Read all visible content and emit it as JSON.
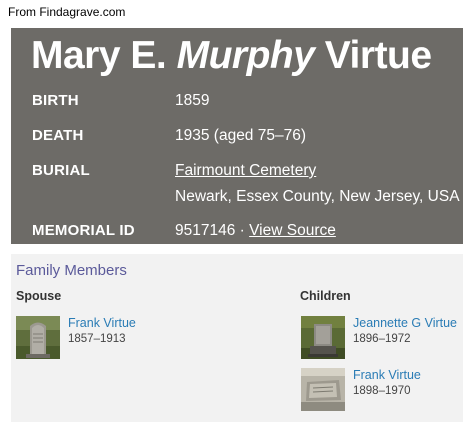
{
  "source_note": "From Findagrave.com",
  "memorial": {
    "name_first": "Mary E.",
    "name_middle": "Murphy",
    "name_last": "Virtue",
    "birth_label": "BIRTH",
    "birth_value": "1859",
    "death_label": "DEATH",
    "death_value": "1935 (aged 75–76)",
    "burial_label": "BURIAL",
    "burial_cemetery": "Fairmount Cemetery",
    "burial_location": "Newark, Essex County, New Jersey, USA",
    "memorial_id_label": "MEMORIAL ID",
    "memorial_id_value": "9517146 · ",
    "view_source_link": "View Source"
  },
  "family": {
    "heading": "Family Members",
    "spouse_heading": "Spouse",
    "children_heading": "Children",
    "spouse": [
      {
        "name": "Frank Virtue",
        "dates": "1857–1913",
        "photo_icon": "gravestone-photo"
      }
    ],
    "children": [
      {
        "name": "Jeannette G Virtue",
        "dates": "1896–1972",
        "photo_icon": "gravestone-photo"
      },
      {
        "name": "Frank Virtue",
        "dates": "1898–1970",
        "photo_icon": "flat-grave-marker-photo"
      }
    ]
  },
  "colors": {
    "card_background": "#6d6b67",
    "panel_background": "#f2f2f2",
    "heading_purple": "#5b5a9a",
    "link_blue": "#2a7cb5"
  }
}
